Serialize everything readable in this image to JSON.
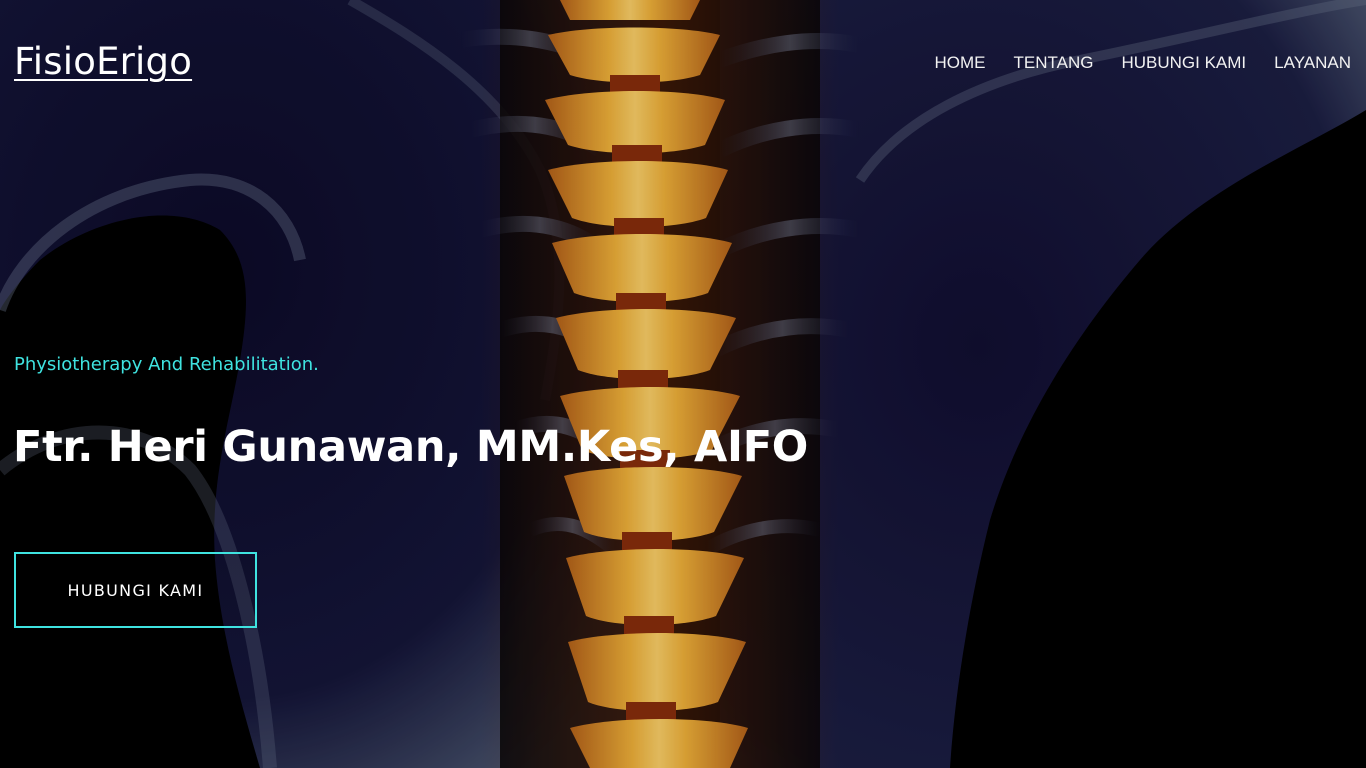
{
  "brand": {
    "name": "FisioErigo"
  },
  "nav": {
    "items": [
      {
        "label": "HOME"
      },
      {
        "label": "TENTANG"
      },
      {
        "label": "HUBUNGI KAMI"
      },
      {
        "label": "LAYANAN"
      }
    ]
  },
  "hero": {
    "tagline": "Physiotherapy And Rehabilitation.",
    "headline": "Ftr. Heri Gunawan, MM.Kes, AIFO",
    "cta_label": "HUBUNGI KAMI",
    "background_image": "spine-xray-back-illustration"
  },
  "colors": {
    "accent": "#3fe3e0",
    "text": "#ffffff",
    "background": "#000000"
  }
}
